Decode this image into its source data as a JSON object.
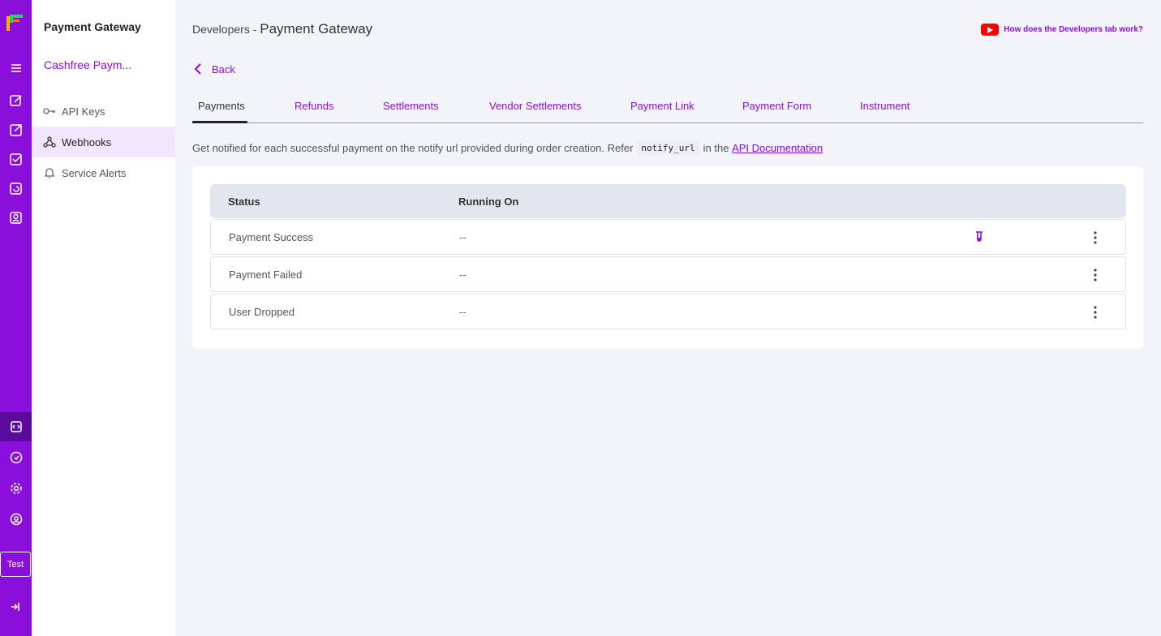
{
  "rail": {
    "colors": {
      "bg": "#8a0fdb",
      "active": "#5c0a9c"
    },
    "env_label": "Test"
  },
  "sidebar": {
    "title": "Payment Gateway",
    "org": "Cashfree Paym...",
    "items": [
      {
        "label": "API Keys",
        "icon": "key-icon"
      },
      {
        "label": "Webhooks",
        "icon": "webhook-icon",
        "active": true
      },
      {
        "label": "Service Alerts",
        "icon": "bell-icon"
      }
    ]
  },
  "header": {
    "prefix": "Developers - ",
    "title": "Payment Gateway",
    "help_link": "How does the Developers tab work?",
    "back": "Back"
  },
  "tabs": [
    "Payments",
    "Refunds",
    "Settlements",
    "Vendor Settlements",
    "Payment Link",
    "Payment Form",
    "Instrument"
  ],
  "description": {
    "text": "Get notified for each successful payment on the notify url provided during order creation. Refer",
    "code": "notify_url",
    "middle": "in the",
    "link": "API Documentation"
  },
  "table": {
    "headers": [
      "Status",
      "Running On"
    ],
    "rows": [
      {
        "status": "Payment Success",
        "running_on": "--"
      },
      {
        "status": "Payment Failed",
        "running_on": "--"
      },
      {
        "status": "User Dropped",
        "running_on": "--"
      }
    ]
  }
}
